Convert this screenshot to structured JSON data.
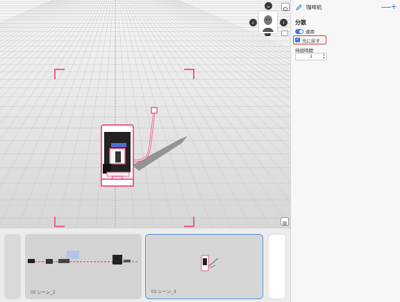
{
  "panel": {
    "title": "咖啡机",
    "minimize_label": "—",
    "add_label": "+",
    "section_title": "分散",
    "apply_label": "適用",
    "reset_label": "元に戻す",
    "duration_label": "持続時間",
    "duration_value": "1"
  },
  "timeline": {
    "scenes": [
      {
        "label": ""
      },
      {
        "label": "02  シーン_2"
      },
      {
        "label": "03  シーン_3"
      },
      {
        "label": ""
      }
    ]
  },
  "icons": {
    "view_cube_top": "chevron-down-icon",
    "view_cube_left": "chevron-left-icon",
    "view_cube_right": "chevron-right-icon",
    "view_cube_bottom": "eye-icon",
    "settings": "settings-icon",
    "layers": "layers-icon",
    "edit": "pencil-icon"
  },
  "colors": {
    "accent": "#3a7be0",
    "highlight": "#e0303a",
    "selection_pink": "#ef5b8a"
  }
}
